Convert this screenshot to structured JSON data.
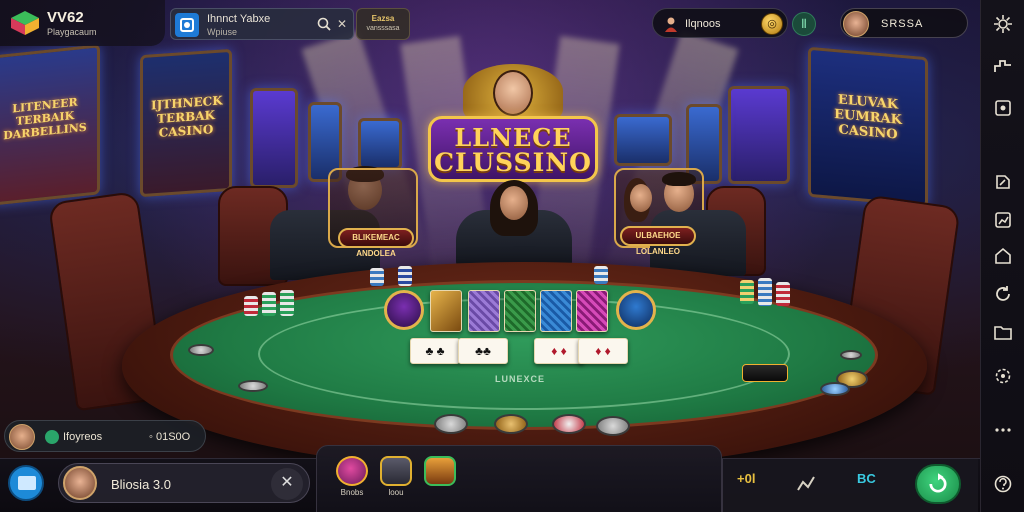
{
  "app": {
    "brand_name": "VV62",
    "brand_sub": "Playgacaum"
  },
  "search": {
    "line1": "Ihnnct Yabxe",
    "line2": "Wpiuse"
  },
  "promo": {
    "line1": "Eazsa",
    "line2": "vansssasa"
  },
  "top_right": {
    "wallet_text": "Ilqnoos",
    "profile_name": "SRSSA"
  },
  "scene": {
    "logo_line1": "LLNECE",
    "logo_line2": "CLUSSINO",
    "left_machine_text": "LITENEER TERBAIK DARBELLINS",
    "left_machine_b_text": "IJTHNECK TERBAK CASINO",
    "right_machine_text": "ELUVAK EUMRAK CASINO",
    "player_left_plate": "BLIKEMEAC ANDOLEA",
    "player_right_plate": "ULBAEHOE LOLANLEO",
    "felt_label": "LUNEXCE"
  },
  "chat": {
    "name": "Ifoyreos",
    "amount": "◦ 01S0O"
  },
  "bottom": {
    "username": "Bliosia 3.0",
    "actions": [
      {
        "label": "Bnobs"
      },
      {
        "label": "loou"
      },
      {
        "label": ""
      }
    ],
    "bet_text": "+0l",
    "bc_text": "BC"
  },
  "colors": {
    "felt": "#1f7a44",
    "rim": "#40150c",
    "accent_gold": "#e3b34c",
    "go_green": "#2fb866",
    "cyan": "#39c9e0"
  }
}
